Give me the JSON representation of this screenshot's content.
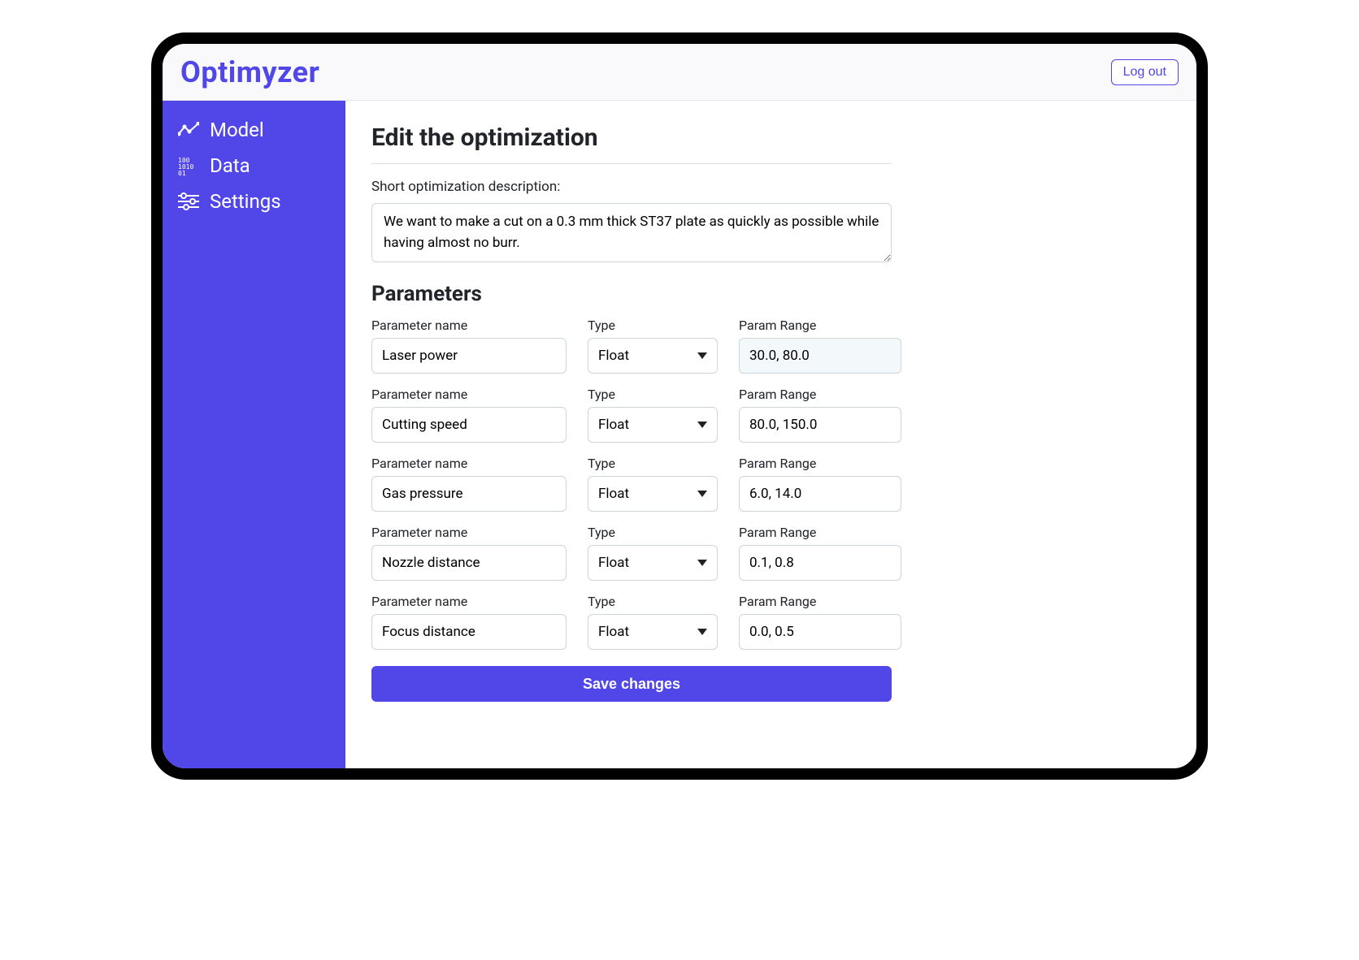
{
  "header": {
    "logo_text": "Optimyzer",
    "logout_label": "Log out"
  },
  "sidebar": {
    "items": [
      {
        "label": "Model",
        "name": "sidebar-item-model",
        "icon": "chart-line-icon"
      },
      {
        "label": "Data",
        "name": "sidebar-item-data",
        "icon": "binary-icon"
      },
      {
        "label": "Settings",
        "name": "sidebar-item-settings",
        "icon": "sliders-icon"
      }
    ]
  },
  "main": {
    "page_title": "Edit the optimization",
    "desc_label": "Short optimization description:",
    "desc_value": "We want to make a cut on a 0.3 mm thick ST37 plate as quickly as possible while having almost no burr.",
    "params_title": "Parameters",
    "labels": {
      "name": "Parameter name",
      "type": "Type",
      "range": "Param Range"
    },
    "parameters": [
      {
        "name": "Laser power",
        "type": "Float",
        "range": "30.0, 80.0",
        "highlight": true
      },
      {
        "name": "Cutting speed",
        "type": "Float",
        "range": "80.0, 150.0",
        "highlight": false
      },
      {
        "name": "Gas pressure",
        "type": "Float",
        "range": "6.0, 14.0",
        "highlight": false
      },
      {
        "name": "Nozzle distance",
        "type": "Float",
        "range": "0.1, 0.8",
        "highlight": false
      },
      {
        "name": "Focus distance",
        "type": "Float",
        "range": "0.0, 0.5",
        "highlight": false
      }
    ],
    "save_label": "Save changes"
  }
}
